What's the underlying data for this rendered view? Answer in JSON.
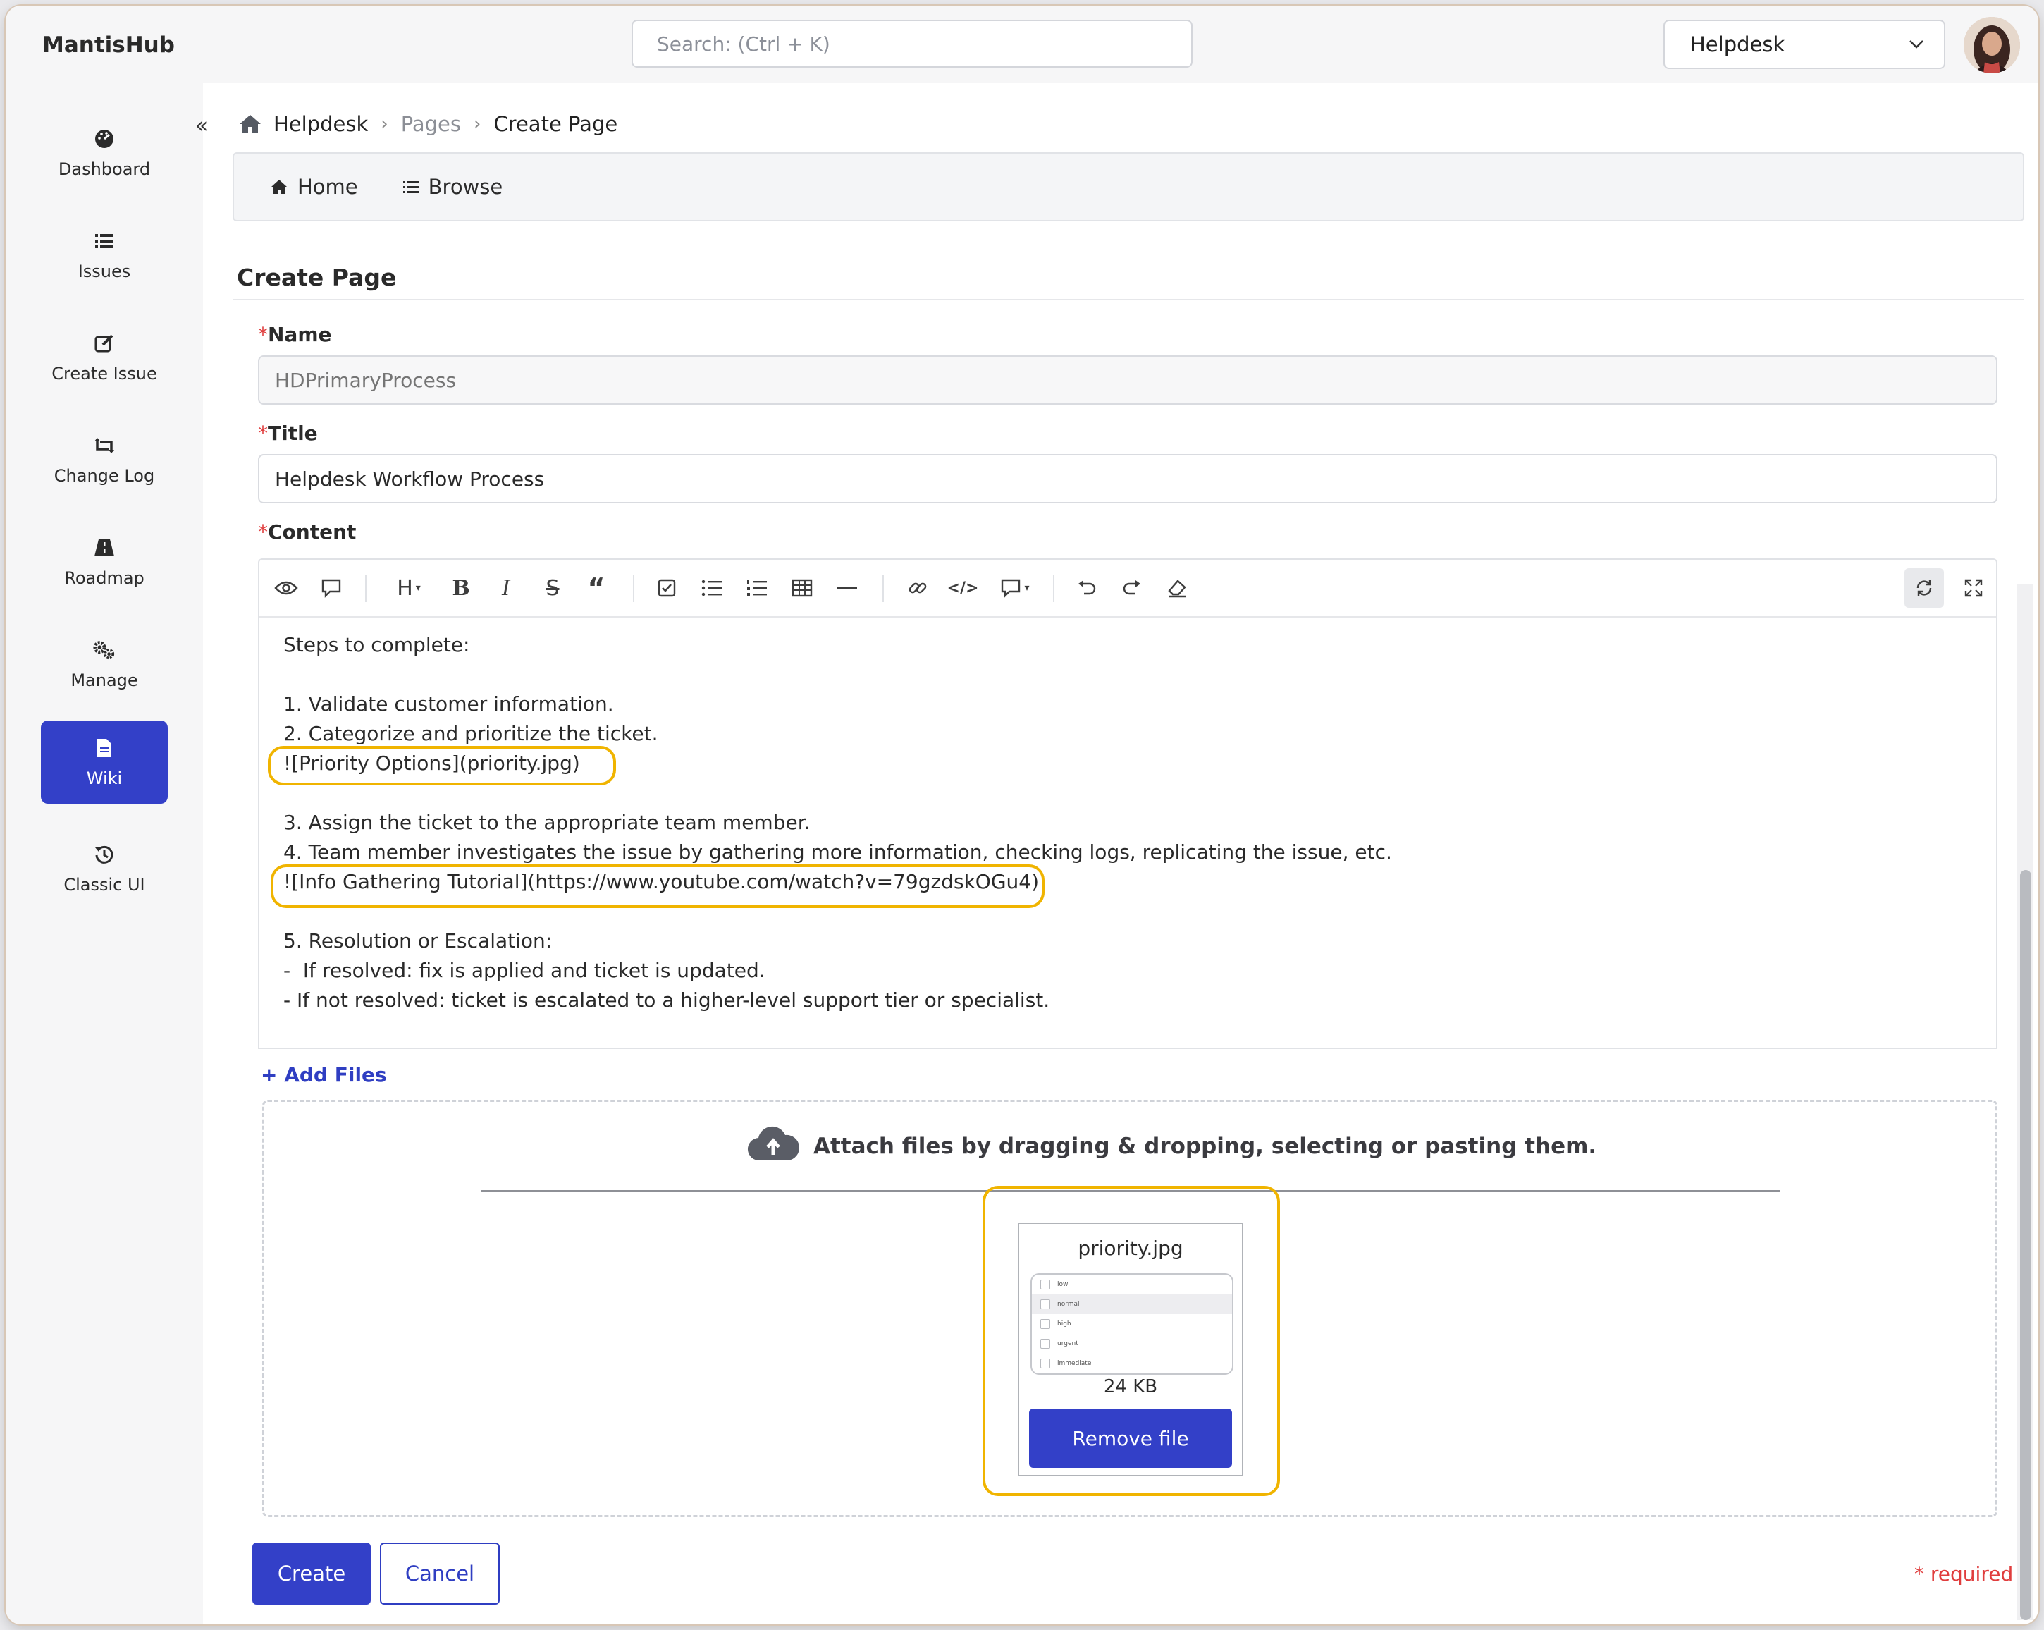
{
  "app": {
    "brand": "MantisHub"
  },
  "header": {
    "search_placeholder": "Search: (Ctrl + K)",
    "project_selected": "Helpdesk"
  },
  "sidebar": {
    "items": [
      {
        "label": "Dashboard",
        "icon": "dashboard-icon"
      },
      {
        "label": "Issues",
        "icon": "list-icon"
      },
      {
        "label": "Create Issue",
        "icon": "edit-icon"
      },
      {
        "label": "Change Log",
        "icon": "change-log-icon"
      },
      {
        "label": "Roadmap",
        "icon": "road-icon"
      },
      {
        "label": "Manage",
        "icon": "gears-icon"
      },
      {
        "label": "Wiki",
        "icon": "document-icon",
        "active": true
      },
      {
        "label": "Classic UI",
        "icon": "history-icon"
      }
    ]
  },
  "breadcrumb": {
    "project": "Helpdesk",
    "section": "Pages",
    "current": "Create Page"
  },
  "subnav": {
    "home": "Home",
    "browse": "Browse"
  },
  "form": {
    "section_title": "Create Page",
    "name_label": "Name",
    "name_placeholder": "HDPrimaryProcess",
    "title_label": "Title",
    "title_value": "Helpdesk Workflow Process",
    "content_label": "Content",
    "required_mark": "*",
    "content_lines": [
      "Steps to complete:",
      "",
      "1. Validate customer information.",
      "2. Categorize and prioritize the ticket.",
      "![Priority Options](priority.jpg)",
      "",
      "3. Assign the ticket to the appropriate team member.",
      "4. Team member investigates the issue by gathering more information, checking logs, replicating the issue, etc.",
      "![Info Gathering Tutorial](https://www.youtube.com/watch?v=79gzdskOGu4)",
      "",
      "5. Resolution or Escalation:",
      "-  If resolved: fix is applied and ticket is updated.",
      "- If not resolved: ticket is escalated to a higher-level support tier or specialist."
    ]
  },
  "attachments": {
    "add_files": "+ Add Files",
    "dropzone_text": "Attach files by dragging & dropping, selecting or pasting them.",
    "file": {
      "name": "priority.jpg",
      "size": "24 KB",
      "remove_label": "Remove file",
      "preview_options": [
        "low",
        "normal",
        "high",
        "urgent",
        "immediate"
      ]
    }
  },
  "actions": {
    "create": "Create",
    "cancel": "Cancel",
    "required_note": "* required"
  },
  "colors": {
    "accent": "#3340c8",
    "highlight": "#f0b400",
    "required": "#e03d3d"
  }
}
